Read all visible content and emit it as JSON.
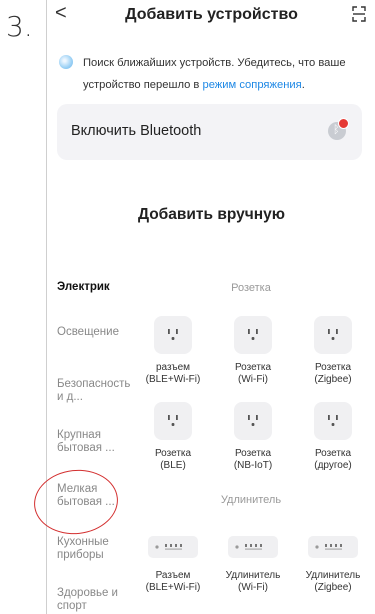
{
  "step_number": "3.",
  "header": {
    "title": "Добавить устройство"
  },
  "search": {
    "text": "Поиск ближайших устройств. Убедитесь, что ваше устройство перешло в ",
    "link": "режим сопряжения",
    "suffix": "."
  },
  "bluetooth": {
    "label": "Включить Bluetooth"
  },
  "manual": {
    "title": "Добавить вручную"
  },
  "categories": [
    {
      "label": "Электрик",
      "active": true
    },
    {
      "label": "Освещение",
      "active": false
    },
    {
      "label": "Безопасность и д...",
      "active": false
    },
    {
      "label": "Крупная бытовая ...",
      "active": false
    },
    {
      "label": "Мелкая бытовая ...",
      "active": false
    },
    {
      "label": "Кухонные приборы",
      "active": false
    },
    {
      "label": "Здоровье и спорт",
      "active": false
    }
  ],
  "sections": {
    "socket": "Розетка",
    "extender": "Удлинитель"
  },
  "devices": [
    {
      "label": "разъем\n(BLE+Wi-Fi)",
      "icon": "socket-icon"
    },
    {
      "label": "Розетка\n(Wi-Fi)",
      "icon": "socket-icon"
    },
    {
      "label": "Розетка\n(Zigbee)",
      "icon": "socket-icon"
    },
    {
      "label": "Розетка\n(BLE)",
      "icon": "socket-icon"
    },
    {
      "label": "Розетка\n(NB-IoT)",
      "icon": "socket-icon"
    },
    {
      "label": "Розетка\n(другое)",
      "icon": "socket-icon"
    },
    {
      "label": "Разъем\n(BLE+Wi-Fi)",
      "icon": "power-strip-icon"
    },
    {
      "label": "Удлинитель\n(Wi-Fi)",
      "icon": "power-strip-icon"
    },
    {
      "label": "Удлинитель\n(Zigbee)",
      "icon": "power-strip-icon"
    }
  ]
}
